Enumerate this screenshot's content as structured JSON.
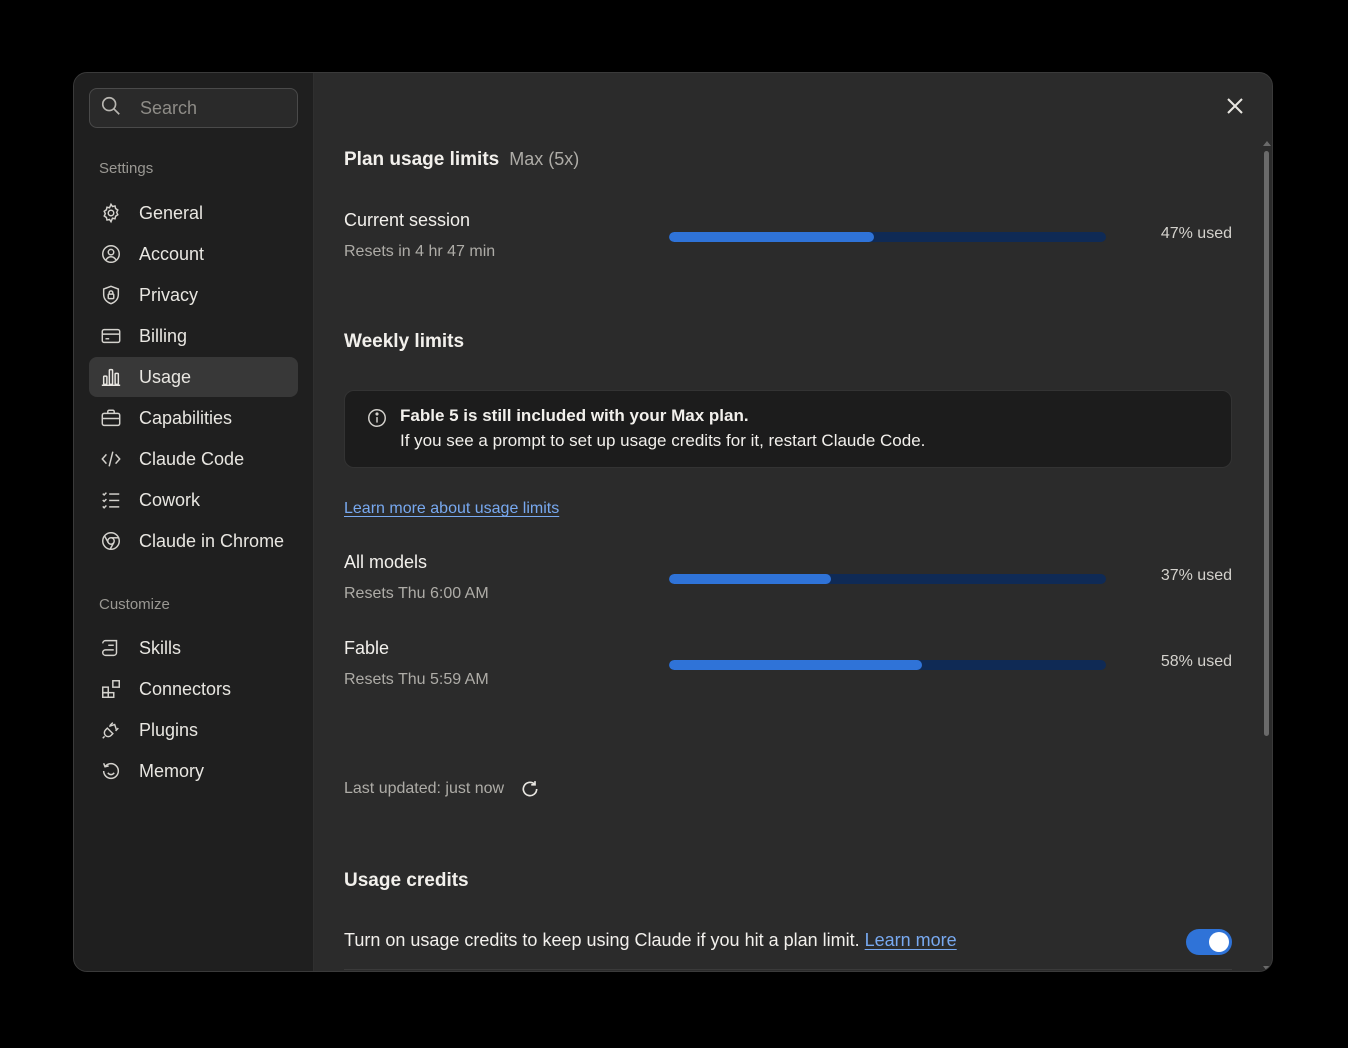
{
  "search": {
    "placeholder": "Search"
  },
  "sidebar": {
    "settings_label": "Settings",
    "settings_items": [
      {
        "label": "General",
        "icon": "gear-icon"
      },
      {
        "label": "Account",
        "icon": "user-circle-icon"
      },
      {
        "label": "Privacy",
        "icon": "shield-lock-icon"
      },
      {
        "label": "Billing",
        "icon": "credit-card-icon"
      },
      {
        "label": "Usage",
        "icon": "bar-chart-icon",
        "active": true
      },
      {
        "label": "Capabilities",
        "icon": "briefcase-icon"
      },
      {
        "label": "Claude Code",
        "icon": "code-icon"
      },
      {
        "label": "Cowork",
        "icon": "checklist-icon"
      },
      {
        "label": "Claude in Chrome",
        "icon": "globe-icon"
      }
    ],
    "customize_label": "Customize",
    "customize_items": [
      {
        "label": "Skills",
        "icon": "scroll-icon"
      },
      {
        "label": "Connectors",
        "icon": "blocks-icon"
      },
      {
        "label": "Plugins",
        "icon": "plug-icon"
      },
      {
        "label": "Memory",
        "icon": "history-icon"
      }
    ]
  },
  "plan": {
    "title": "Plan usage limits",
    "badge": "Max (5x)",
    "current_session": {
      "name": "Current session",
      "resets": "Resets in 4 hr 47 min",
      "percent": 47,
      "label": "47% used"
    }
  },
  "weekly": {
    "title": "Weekly limits",
    "notice_bold": "Fable 5 is still included with your Max plan.",
    "notice_text": "If you see a prompt to set up usage credits for it, restart Claude Code.",
    "learn_more": "Learn more about usage limits",
    "rows": [
      {
        "name": "All models",
        "resets": "Resets Thu 6:00 AM",
        "percent": 37,
        "label": "37% used"
      },
      {
        "name": "Fable",
        "resets": "Resets Thu 5:59 AM",
        "percent": 58,
        "label": "58% used"
      }
    ]
  },
  "last_updated": "Last updated: just now",
  "credits": {
    "title": "Usage credits",
    "text": "Turn on usage credits to keep using Claude if you hit a plan limit.",
    "link": "Learn more",
    "enabled": true
  },
  "colors": {
    "accent": "#2f73d8",
    "bar_track": "#0f2a55",
    "link": "#78a9f0"
  }
}
